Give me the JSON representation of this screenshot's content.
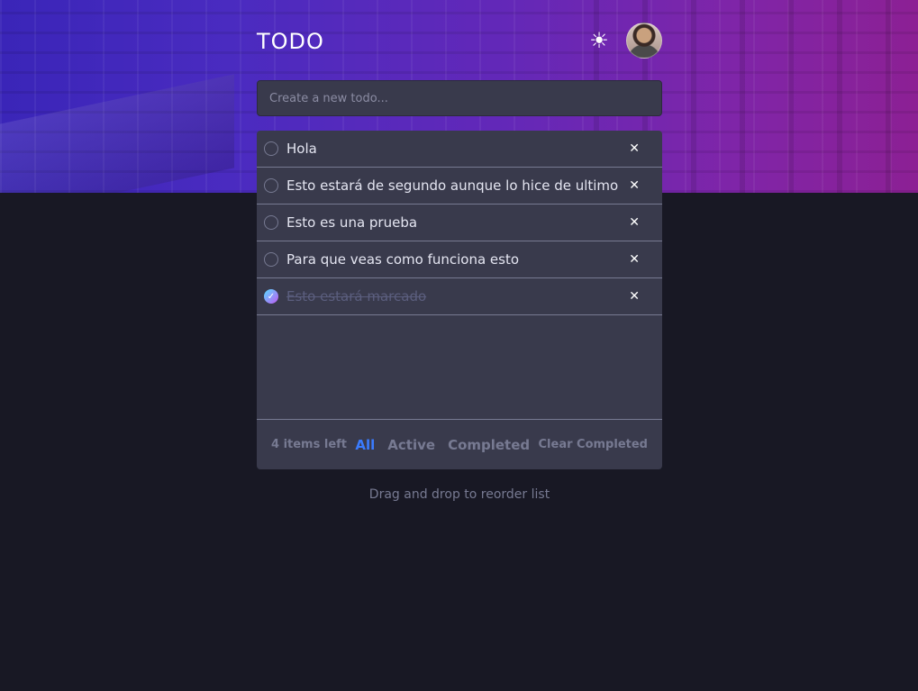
{
  "header": {
    "title": "TODO",
    "theme_icon": "sun-icon",
    "avatar_icon": "avatar"
  },
  "new_todo": {
    "placeholder": "Create a new todo..."
  },
  "todos": [
    {
      "text": "Hola",
      "completed": false
    },
    {
      "text": "Esto estará de segundo aunque lo hice de ultimo",
      "completed": false
    },
    {
      "text": "Esto es una prueba",
      "completed": false
    },
    {
      "text": "Para que veas como funciona esto",
      "completed": false
    },
    {
      "text": "Esto estará marcado",
      "completed": true
    }
  ],
  "footer": {
    "items_left": "4 items left",
    "filters": [
      "All",
      "Active",
      "Completed"
    ],
    "active_filter": "All",
    "clear_label": "Clear Completed"
  },
  "hint": "Drag and drop to reorder list",
  "colors": {
    "background": "#181824",
    "card": "#393a4c",
    "accent": "#3a7bfd",
    "muted": "#777a92",
    "check_gradient_start": "#57ddff",
    "check_gradient_end": "#c058f3"
  }
}
